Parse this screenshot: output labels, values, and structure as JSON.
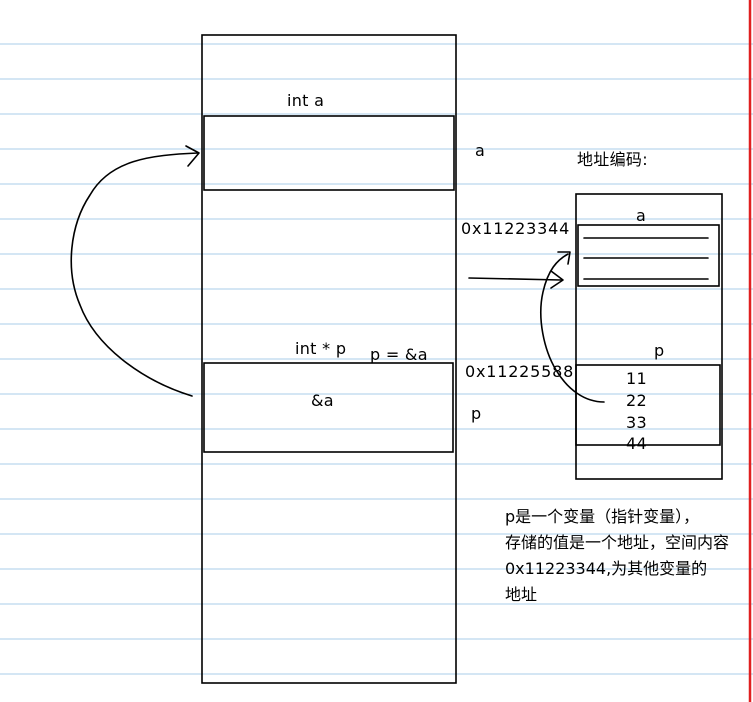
{
  "colors": {
    "ruled_line": "#a9cde8",
    "margin_line": "#e02020",
    "ink": "#000000"
  },
  "labels": {
    "int_a": "int a",
    "a_right": "a",
    "addr_title": "地址编码:",
    "addr_a_box_label": "a",
    "addr_a": "0x11223344",
    "int_ptr": "int * p",
    "p_assign": "p = &a",
    "addr_p": "0x11225588",
    "p_value": "&a",
    "p_right": "p",
    "addr_p_box_label": "p",
    "p_bytes": [
      "11",
      "22",
      "33",
      "44"
    ]
  },
  "note": [
    "p是一个变量（指针变量），",
    "存储的值是一个地址，空间内容",
    "0x11223344,为其他变量的",
    "地址"
  ]
}
